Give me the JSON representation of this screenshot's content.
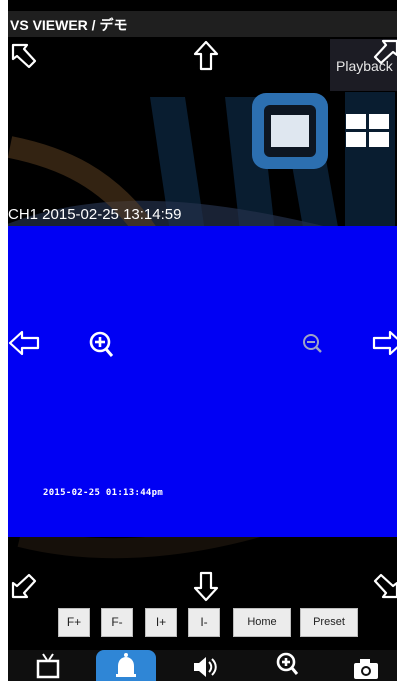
{
  "app": {
    "title": "VS VIEWER / デモ"
  },
  "top_controls": {
    "playback_label": "Playback"
  },
  "channel": {
    "label": "CH1 2015-02-25 13:14:59"
  },
  "video": {
    "osd_timestamp": "2015-02-25 01:13:44pm",
    "background_color": "#0000f4"
  },
  "ptz": {
    "buttons": [
      "F+",
      "F-",
      "I+",
      "I-",
      "Home",
      "Preset"
    ]
  },
  "bottom_nav": {
    "items": [
      "tv-icon",
      "bell-icon",
      "speaker-icon",
      "zoom-in-icon",
      "camera-icon"
    ],
    "active_item": "bell-icon",
    "accent_color": "#2f86d6"
  },
  "icons": {
    "arrows": [
      "arrow-up-left-icon",
      "arrow-up-icon",
      "arrow-up-right-icon",
      "arrow-left-icon",
      "arrow-right-icon",
      "arrow-down-left-icon",
      "arrow-down-icon",
      "arrow-down-right-icon"
    ],
    "zoom": [
      "zoom-in-icon",
      "zoom-out-icon"
    ]
  },
  "colors": {
    "view_toggle": "#2c6fb0",
    "title_bar": "#1f1f1f"
  }
}
